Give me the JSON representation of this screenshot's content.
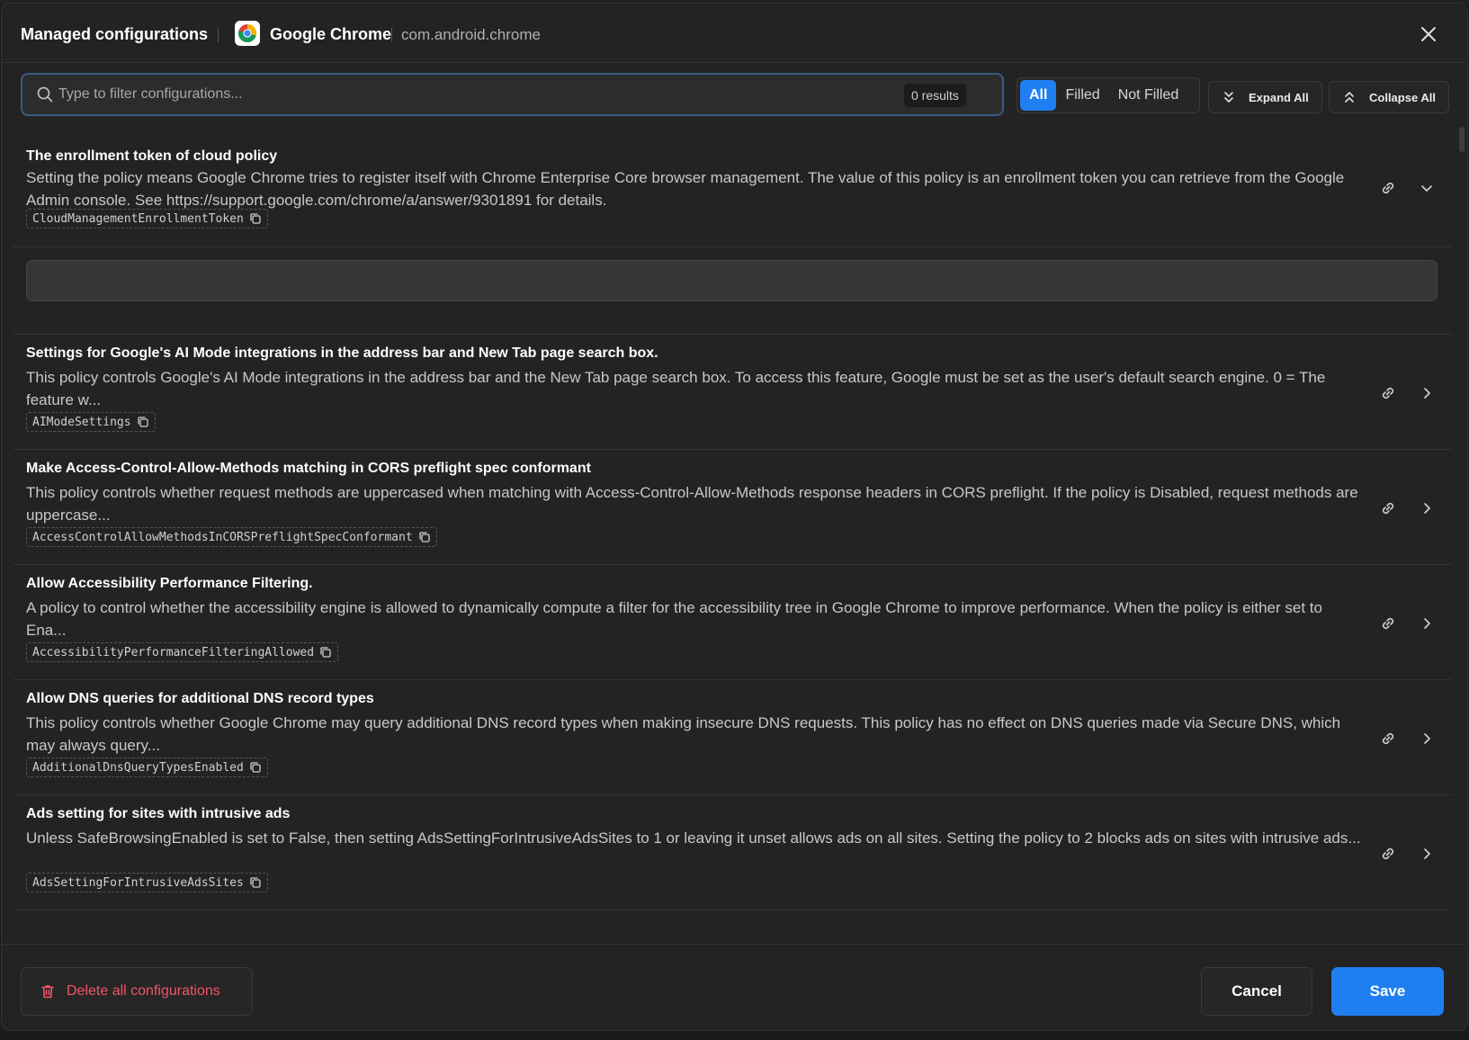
{
  "header": {
    "title": "Managed configurations",
    "app_name": "Google Chrome",
    "package_name": "com.android.chrome"
  },
  "toolbar": {
    "search_placeholder": "Type to filter configurations...",
    "results": "0 results",
    "filters": [
      "All",
      "Filled",
      "Not Filled"
    ],
    "active_filter": "All",
    "expand_all": "Expand All",
    "collapse_all": "Collapse All"
  },
  "items": [
    {
      "title": "The enrollment token of cloud policy",
      "description": "Setting the policy means Google Chrome tries to register itself with Chrome Enterprise Core browser management. The value of this policy is an enrollment token you can retrieve from the Google Admin console. See https://support.google.com/chrome/a/answer/9301891 for details.",
      "key": "CloudManagementEnrollmentToken",
      "expanded": true,
      "value": ""
    },
    {
      "title": "Settings for Google's AI Mode integrations in the address bar and New Tab page search box.",
      "description": "This policy controls Google's AI Mode integrations in the address bar and the New Tab page search box. To access this feature, Google must be set as the user's default search engine. 0 = The feature w...",
      "key": "AIModeSettings",
      "expanded": false
    },
    {
      "title": "Make Access-Control-Allow-Methods matching in CORS preflight spec conformant",
      "description": "This policy controls whether request methods are uppercased when matching with Access-Control-Allow-Methods response headers in CORS preflight. If the policy is Disabled, request methods are uppercase...",
      "key": "AccessControlAllowMethodsInCORSPreflightSpecConformant",
      "expanded": false
    },
    {
      "title": "Allow Accessibility Performance Filtering.",
      "description": "A policy to control whether the accessibility engine is allowed to dynamically compute a filter for the accessibility tree in Google Chrome to improve performance. When the policy is either set to Ena...",
      "key": "AccessibilityPerformanceFilteringAllowed",
      "expanded": false
    },
    {
      "title": "Allow DNS queries for additional DNS record types",
      "description": "This policy controls whether Google Chrome may query additional DNS record types when making insecure DNS requests. This policy has no effect on DNS queries made via Secure DNS, which may always query...",
      "key": "AdditionalDnsQueryTypesEnabled",
      "expanded": false
    },
    {
      "title": "Ads setting for sites with intrusive ads",
      "description": "Unless SafeBrowsingEnabled is set to False, then setting AdsSettingForIntrusiveAdsSites to 1 or leaving it unset allows ads on all sites. Setting the policy to 2 blocks ads on sites with intrusive ads...",
      "key": "AdsSettingForIntrusiveAdsSites",
      "expanded": false
    }
  ],
  "footer": {
    "delete_all": "Delete all configurations",
    "cancel": "Cancel",
    "save": "Save"
  },
  "colors": {
    "accent": "#1f7ff0",
    "danger": "#ef5566",
    "background": "#232323"
  }
}
